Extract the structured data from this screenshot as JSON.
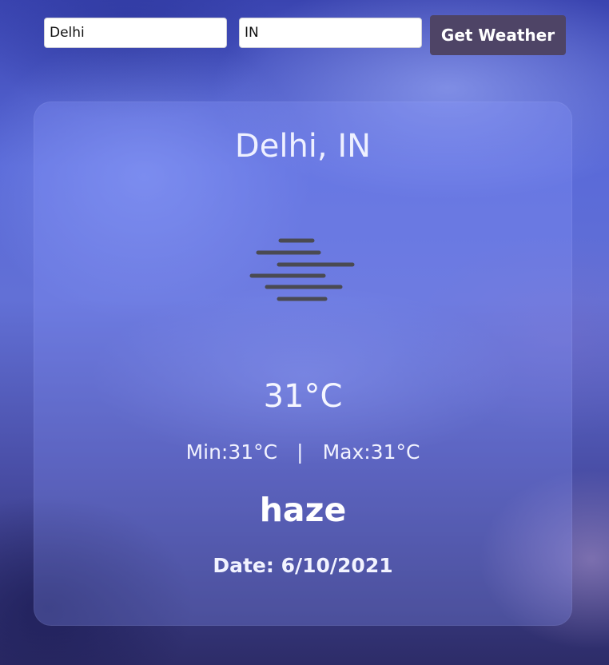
{
  "search": {
    "city_value": "Delhi",
    "country_value": "IN",
    "button_label": "Get Weather"
  },
  "weather": {
    "location": "Delhi, IN",
    "icon": "haze-icon",
    "temperature": "31°C",
    "min": "Min:31°C",
    "separator": "|",
    "max": "Max:31°C",
    "condition": "haze",
    "date": "Date: 6/10/2021"
  },
  "colors": {
    "button_bg": "#4e4466",
    "card_bg": "rgba(140,155,255,0.28)",
    "icon_stroke": "#4a4a52"
  }
}
